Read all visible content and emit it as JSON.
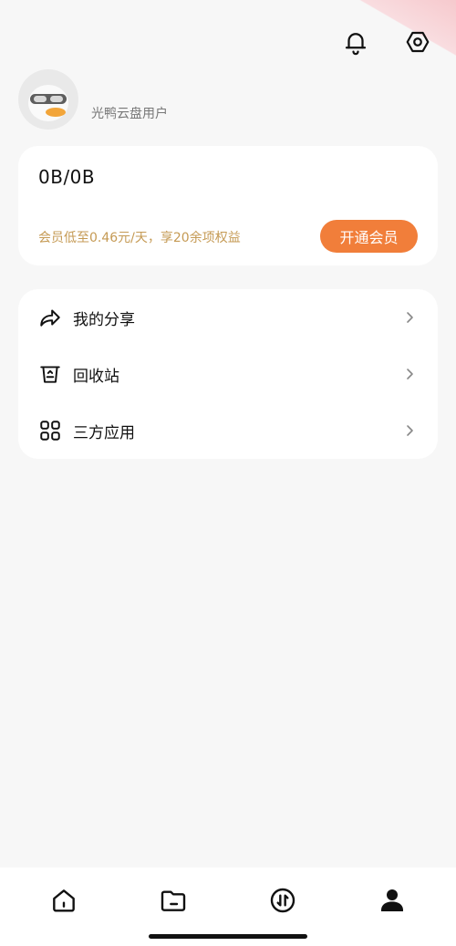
{
  "profile": {
    "username": "光鸭云盘用户"
  },
  "storage": {
    "usage": "0B/0B"
  },
  "promo": {
    "text": "会员低至0.46元/天，享20余项权益",
    "button_label": "开通会员",
    "accent_color": "#f17e3a",
    "text_color": "#c59a54"
  },
  "menu": {
    "items": [
      {
        "label": "我的分享",
        "icon": "share-arrow-icon"
      },
      {
        "label": "回收站",
        "icon": "recycle-bin-icon"
      },
      {
        "label": "三方应用",
        "icon": "apps-grid-icon"
      }
    ]
  },
  "header": {
    "icons": [
      "bell-icon",
      "settings-icon"
    ]
  },
  "bottom_nav": {
    "items": [
      "home-icon",
      "folder-icon",
      "transfer-icon",
      "profile-icon"
    ],
    "active": "profile-icon"
  }
}
